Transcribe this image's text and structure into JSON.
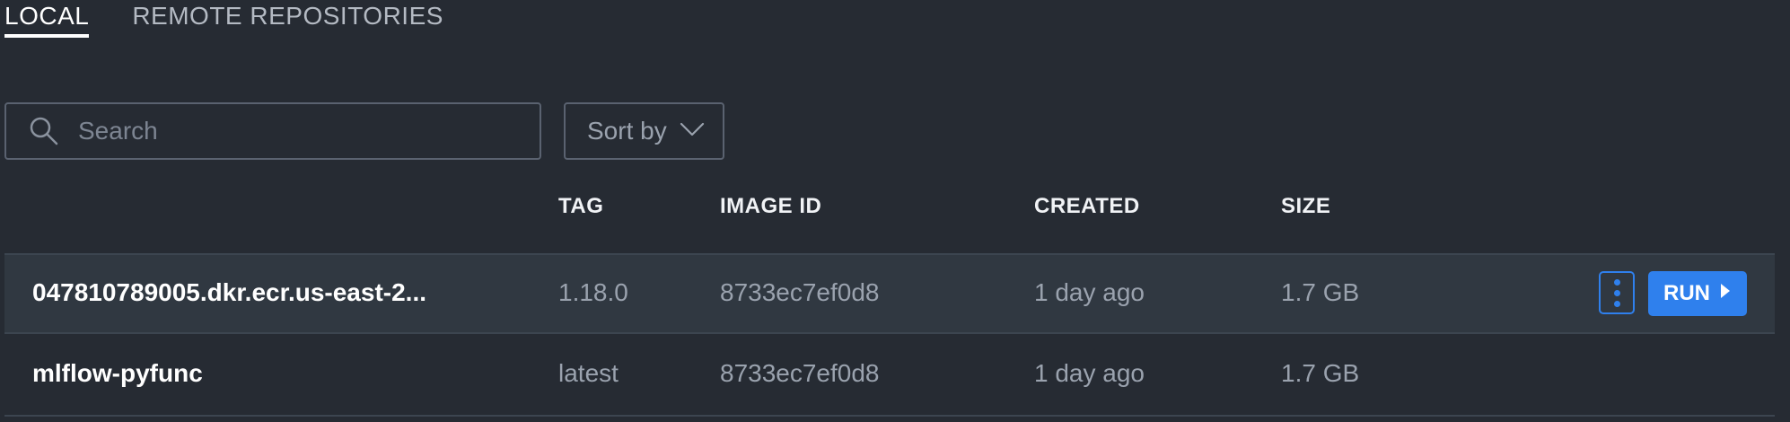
{
  "tabs": [
    {
      "label": "LOCAL",
      "active": true
    },
    {
      "label": "REMOTE REPOSITORIES",
      "active": false
    }
  ],
  "search": {
    "placeholder": "Search",
    "value": "",
    "icon": "search-icon"
  },
  "sort": {
    "label": "Sort by",
    "icon": "chevron-down-icon"
  },
  "table": {
    "columns": [
      "TAG",
      "IMAGE ID",
      "CREATED",
      "SIZE"
    ],
    "rows": [
      {
        "name": "047810789005.dkr.ecr.us-east-2...",
        "tag": "1.18.0",
        "image_id": "8733ec7ef0d8",
        "created": "1 day ago",
        "size": "1.7 GB"
      },
      {
        "name": "mlflow-pyfunc",
        "tag": "latest",
        "image_id": "8733ec7ef0d8",
        "created": "1 day ago",
        "size": "1.7 GB"
      }
    ]
  },
  "actions": {
    "run_label": "RUN",
    "menu_icon": "kebab-menu-icon",
    "run_icon": "play-icon"
  },
  "colors": {
    "background": "#262b33",
    "accent": "#2f80ed",
    "row_highlight": "#303841"
  }
}
